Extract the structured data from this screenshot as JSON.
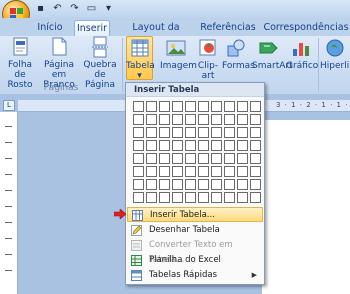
{
  "tabs": [
    "Início",
    "Inserir",
    "Layout da Página",
    "Referências",
    "Correspondências"
  ],
  "active_tab": "Inserir",
  "ribbon": {
    "buttons": {
      "folha_de_rosto": [
        "Folha de",
        "Rosto"
      ],
      "pagina_em_branco": [
        "Página em",
        "Branco"
      ],
      "quebra_de_pagina": [
        "Quebra",
        "de Página"
      ],
      "tabela": "Tabela",
      "imagem": "Imagem",
      "clip_art": "Clip-art",
      "formas": "Formas",
      "smartart": "SmartArt",
      "grafico": "Gráfico",
      "hiperlink": "Hiperlin"
    },
    "group_paginas": "Páginas"
  },
  "ruler_text": "3 · 1 · 2 · 1 · 1 ·",
  "ruler_button": "L",
  "dropdown": {
    "header": "Inserir Tabela",
    "grid_cols": 10,
    "grid_rows": 8,
    "items": [
      {
        "label": "Inserir Tabela...",
        "icon": "insert-table-icon",
        "highlighted": true,
        "disabled": false
      },
      {
        "label": "Desenhar Tabela",
        "icon": "pencil-icon",
        "highlighted": false,
        "disabled": false
      },
      {
        "label": "Converter Texto em Tabela...",
        "icon": "convert-table-icon",
        "highlighted": false,
        "disabled": true
      },
      {
        "label": "Planilha do Excel",
        "icon": "excel-sheet-icon",
        "highlighted": false,
        "disabled": false
      },
      {
        "label": "Tabelas Rápidas",
        "icon": "quick-tables-icon",
        "highlighted": false,
        "disabled": false,
        "submenu": true
      }
    ]
  },
  "colors": {
    "accent_orange": "#ffc84a",
    "ribbon_text": "#15428b",
    "pointer_red": "#e02020"
  }
}
